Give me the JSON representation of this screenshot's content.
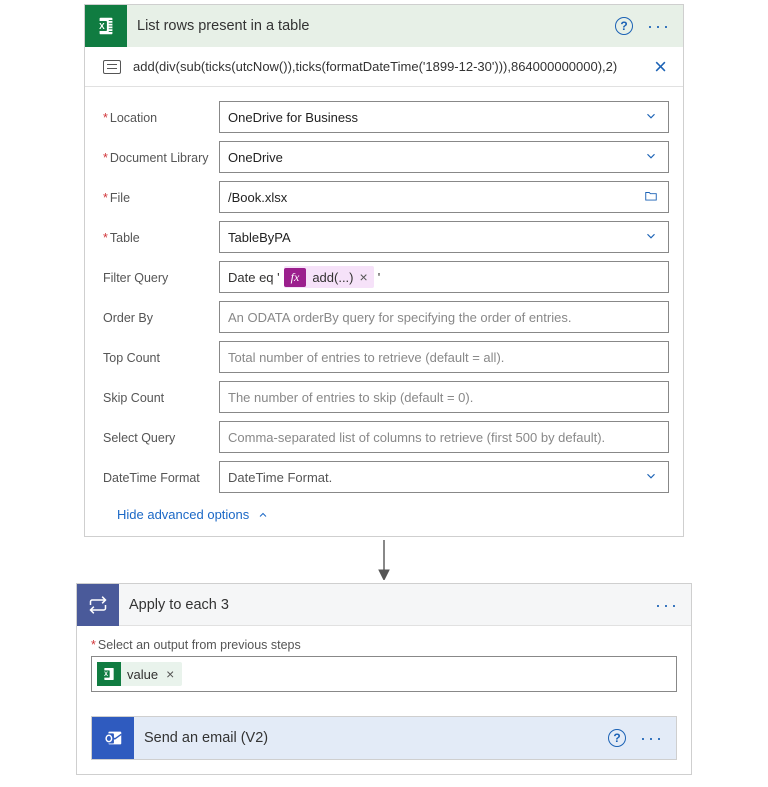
{
  "list_rows": {
    "title": "List rows present in a table",
    "peek_code": "add(div(sub(ticks(utcNow()),ticks(formatDateTime('1899-12-30'))),864000000000),2)",
    "fields": {
      "location": {
        "label": "Location",
        "required": true,
        "value": "OneDrive for Business",
        "control": "dropdown"
      },
      "documentLibrary": {
        "label": "Document Library",
        "required": true,
        "value": "OneDrive",
        "control": "dropdown"
      },
      "file": {
        "label": "File",
        "required": true,
        "value": "/Book.xlsx",
        "control": "file"
      },
      "table": {
        "label": "Table",
        "required": true,
        "value": "TableByPA",
        "control": "dropdown"
      },
      "filterQuery": {
        "label": "Filter Query",
        "required": false,
        "value_prefix": "Date eq '",
        "fx_label": "add(...)",
        "value_suffix": "'",
        "control": "expr"
      },
      "orderBy": {
        "label": "Order By",
        "required": false,
        "placeholder": "An ODATA orderBy query for specifying the order of entries.",
        "control": "text"
      },
      "topCount": {
        "label": "Top Count",
        "required": false,
        "placeholder": "Total number of entries to retrieve (default = all).",
        "control": "text"
      },
      "skipCount": {
        "label": "Skip Count",
        "required": false,
        "placeholder": "The number of entries to skip (default = 0).",
        "control": "text"
      },
      "selectQuery": {
        "label": "Select Query",
        "required": false,
        "placeholder": "Comma-separated list of columns to retrieve (first 500 by default).",
        "control": "text"
      },
      "dateTimeFormat": {
        "label": "DateTime Format",
        "required": false,
        "value": "DateTime Format.",
        "control": "dropdown"
      }
    },
    "advanced_toggle": "Hide advanced options"
  },
  "apply_each": {
    "title": "Apply to each 3",
    "select_output_label": "Select an output from previous steps",
    "token_label": "value"
  },
  "send_email": {
    "title": "Send an email (V2)"
  }
}
